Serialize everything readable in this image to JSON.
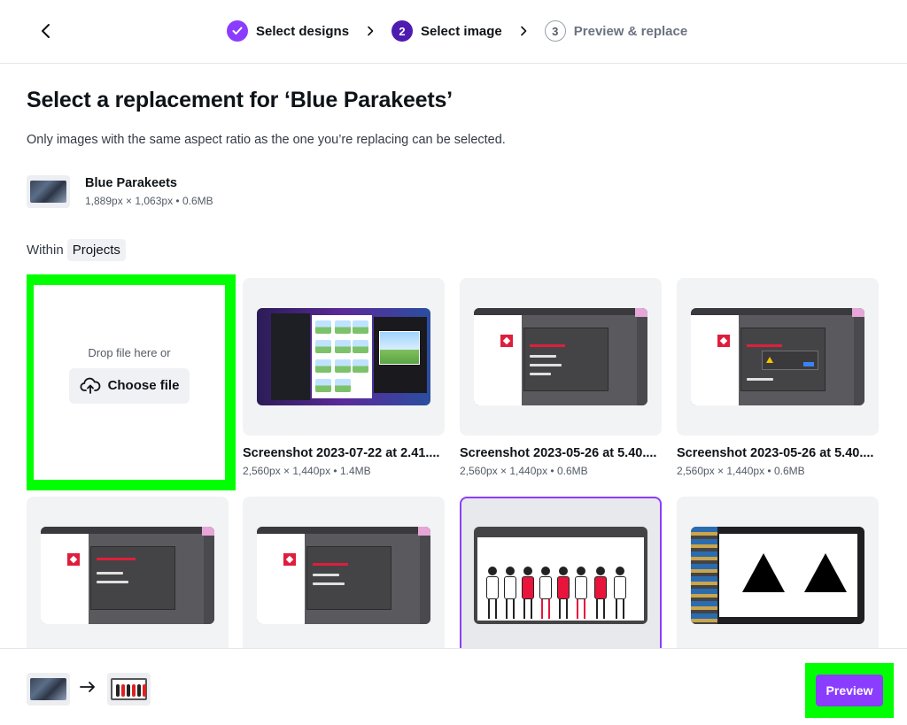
{
  "header": {
    "steps": [
      {
        "number": "",
        "label": "Select designs",
        "status": "done"
      },
      {
        "number": "2",
        "label": "Select image",
        "status": "active"
      },
      {
        "number": "3",
        "label": "Preview & replace",
        "status": "pending"
      }
    ]
  },
  "main": {
    "title": "Select a replacement for ‘Blue Parakeets’",
    "subtitle": "Only images with the same aspect ratio as the one you’re replacing can be selected.",
    "current_image": {
      "name": "Blue Parakeets",
      "meta": "1,889px × 1,063px • 0.6MB"
    },
    "within_label": "Within",
    "within_chip": "Projects",
    "upload": {
      "drop_text": "Drop file here or",
      "button_label": "Choose file"
    },
    "images": [
      {
        "name": "Screenshot 2023-07-22 at 2.41....",
        "meta": "2,560px × 1,440px • 1.4MB"
      },
      {
        "name": "Screenshot 2023-05-26 at 5.40....",
        "meta": "2,560px × 1,440px • 0.6MB"
      },
      {
        "name": "Screenshot 2023-05-26 at 5.40....",
        "meta": "2,560px × 1,440px • 0.6MB"
      }
    ]
  },
  "footer": {
    "preview_label": "Preview"
  },
  "colors": {
    "accent": "#8b3dff",
    "active_step": "#4d1bb0",
    "highlight": "#00ff00"
  }
}
